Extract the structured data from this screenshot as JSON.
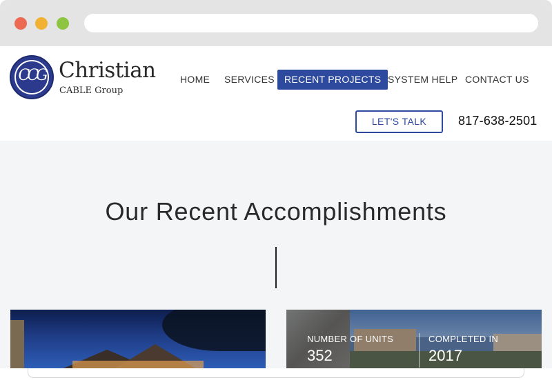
{
  "browser": {
    "buttons": [
      "close",
      "minimize",
      "maximize"
    ],
    "address_bar": ""
  },
  "header": {
    "logo": {
      "monogram": "CCG",
      "title": "Christian",
      "subtitle": "CABLE Group",
      "brand_color": "#2b3a8c"
    },
    "nav": {
      "home": "HOME",
      "services": "SERVICES",
      "recent_projects": "RECENT PROJECTS",
      "system_help": "SYSTEM HELP",
      "contact_us": "CONTACT US",
      "active": "RECENT PROJECTS",
      "active_color": "#2e4a9e"
    },
    "cta_label": "LET'S TALK",
    "phone": "817-638-2501"
  },
  "main": {
    "headline": "Our Recent Accomplishments",
    "projects": [
      {},
      {
        "stats": {
          "units_label": "NUMBER OF UNITS",
          "units_value": "352",
          "completed_label": "COMPLETED IN",
          "completed_value": "2017"
        }
      }
    ]
  }
}
